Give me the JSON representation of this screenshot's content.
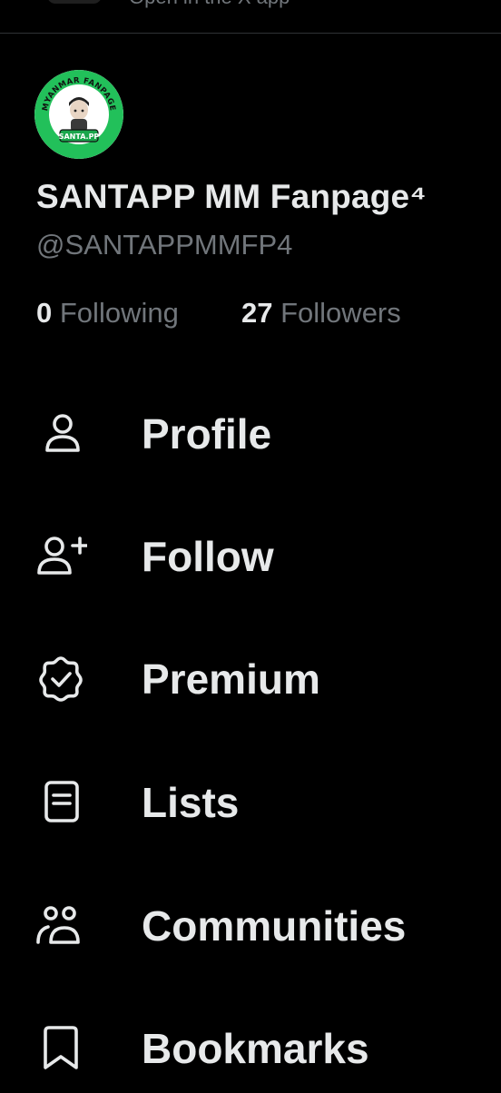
{
  "top_bar": {
    "open_in_app": "Open in the X app"
  },
  "profile": {
    "avatar_text_top": "MYANMAR FANPAGE",
    "avatar_text_bottom": "SANTA.PP",
    "display_name": "SANTAPP MM Fanpage⁴",
    "handle": "@SANTAPPMMFP4",
    "following_count": "0",
    "following_label": "Following",
    "followers_count": "27",
    "followers_label": "Followers"
  },
  "menu": {
    "items": [
      {
        "label": "Profile",
        "icon": "person-icon"
      },
      {
        "label": "Follow",
        "icon": "person-add-icon"
      },
      {
        "label": "Premium",
        "icon": "verified-badge-icon"
      },
      {
        "label": "Lists",
        "icon": "list-icon"
      },
      {
        "label": "Communities",
        "icon": "communities-icon"
      },
      {
        "label": "Bookmarks",
        "icon": "bookmark-icon"
      }
    ]
  },
  "colors": {
    "background": "#000000",
    "text_primary": "#e7e9ea",
    "text_secondary": "#71767b",
    "avatar_green": "#22c05a"
  }
}
